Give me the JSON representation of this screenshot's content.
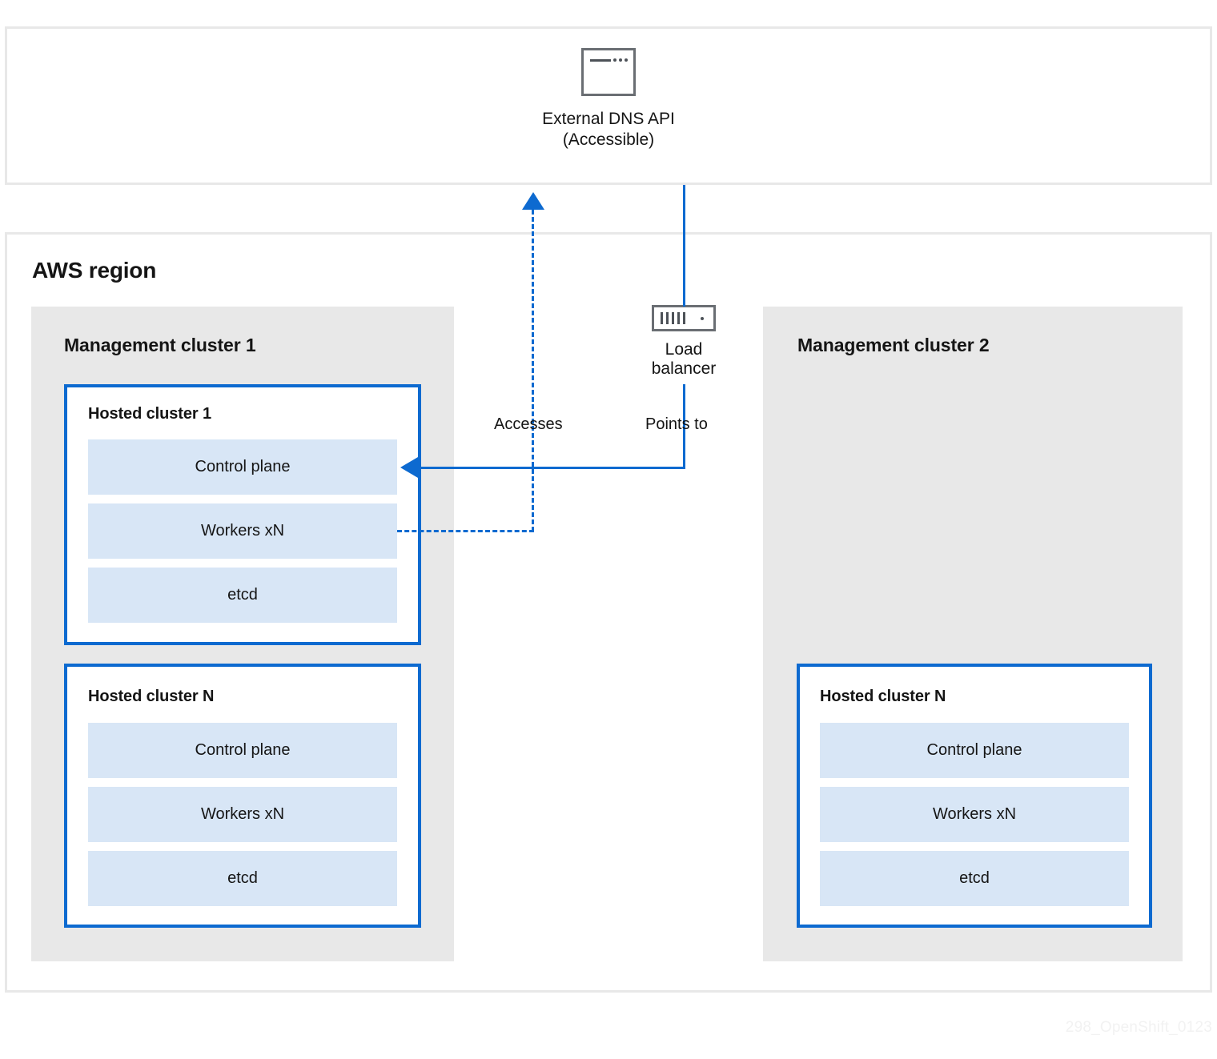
{
  "diagram": {
    "region_title": "AWS region",
    "watermark": "298_OpenShift_0123",
    "accent_blue": "#0d6ad0",
    "component_fill": "#d8e6f6",
    "panel_gray": "#e8e8e8",
    "icon_gray": "#6a6e73"
  },
  "external": {
    "icon": "browser-window-icon",
    "title": "External DNS API",
    "subtitle": "(Accessible)"
  },
  "load_balancer": {
    "icon": "server-rack-icon",
    "label_line1": "Load",
    "label_line2": "balancer"
  },
  "edges": [
    {
      "label": "Accesses",
      "style": "dashed",
      "from": "Workers xN",
      "to": "External DNS API"
    },
    {
      "label": "Points to",
      "style": "solid",
      "from": "Load balancer",
      "to": "Control plane"
    }
  ],
  "management_clusters": [
    {
      "title": "Management cluster 1",
      "hosted_clusters": [
        {
          "title": "Hosted cluster 1",
          "components": [
            "Control plane",
            "Workers xN",
            "etcd"
          ]
        },
        {
          "title": "Hosted cluster N",
          "components": [
            "Control plane",
            "Workers xN",
            "etcd"
          ]
        }
      ]
    },
    {
      "title": "Management cluster 2",
      "hosted_clusters": [
        {
          "title": "Hosted cluster N",
          "components": [
            "Control plane",
            "Workers xN",
            "etcd"
          ]
        }
      ]
    }
  ]
}
